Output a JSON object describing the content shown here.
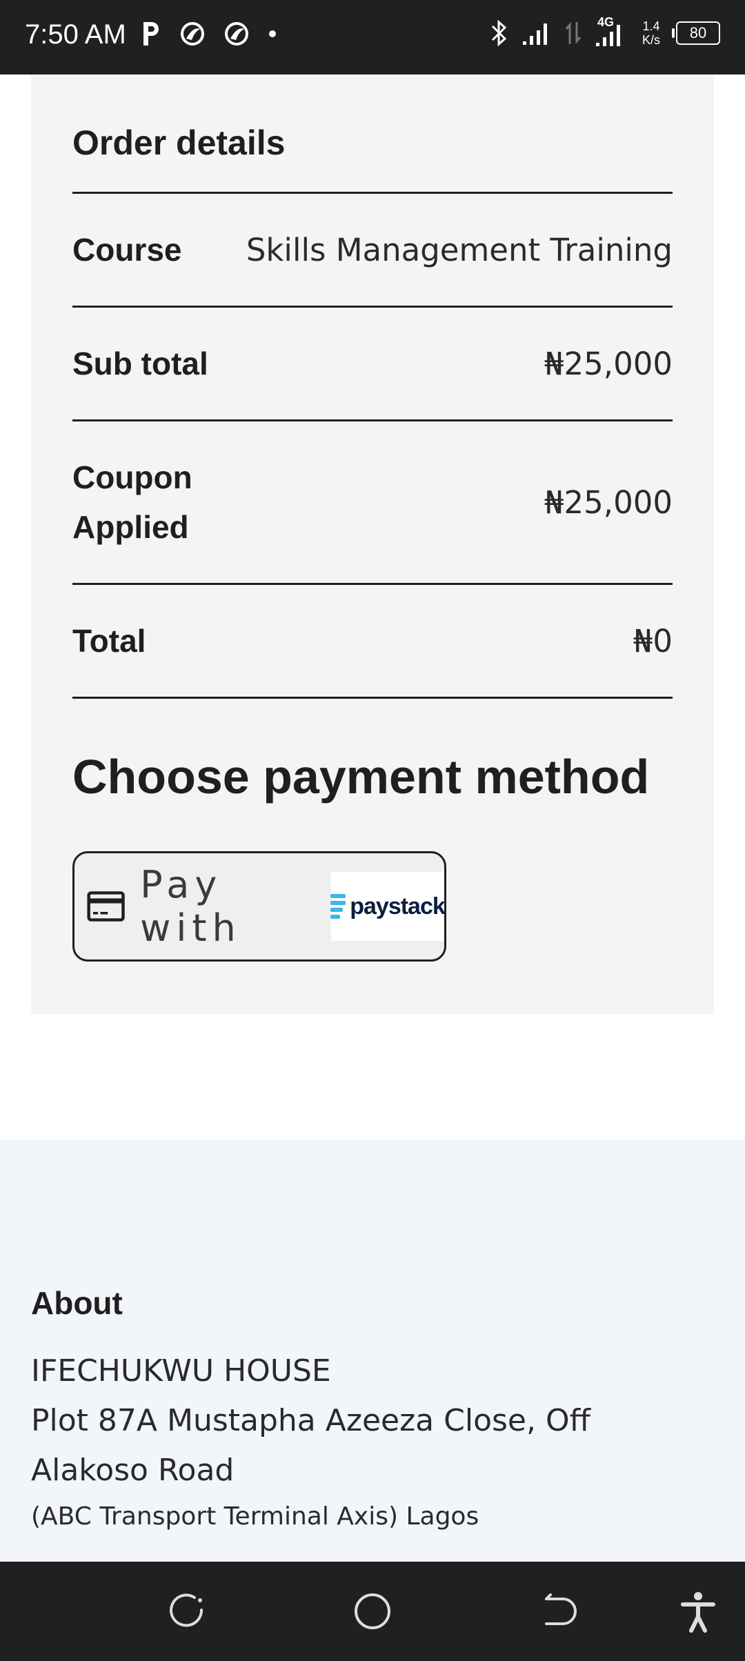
{
  "status_bar": {
    "time": "7:50 AM",
    "net_speed_value": "1.4",
    "net_speed_unit": "K/s",
    "network_type": "4G",
    "battery": "80",
    "icons": [
      "parking-icon",
      "bird-icon",
      "bird-icon",
      "dot-icon",
      "bluetooth-icon",
      "signal-icon",
      "data-arrows-icon",
      "signal-4g-icon",
      "battery-icon"
    ]
  },
  "order": {
    "title": "Order details",
    "rows": [
      {
        "label": "Course",
        "value": "Skills Management Training"
      },
      {
        "label": "Sub total",
        "value": "₦25,000"
      },
      {
        "label": "Coupon Applied",
        "value": "₦25,000"
      },
      {
        "label": "Total",
        "value": "₦0"
      }
    ]
  },
  "payment": {
    "title": "Choose payment method",
    "button_label": "Pay with",
    "provider_logo_text": "paystack",
    "icon": "credit-card-icon"
  },
  "footer": {
    "about_title": "About",
    "address_line1": "IFECHUKWU HOUSE",
    "address_line2": "Plot 87A Mustapha Azeeza Close, Off Alakoso Road",
    "address_line3": "(ABC Transport Terminal Axis) Lagos"
  },
  "nav_bar": {
    "buttons": [
      "recents-icon",
      "home-icon",
      "back-icon",
      "accessibility-icon"
    ]
  },
  "colors": {
    "card_bg": "#f4f4f4",
    "footer_bg": "#f2f5fa",
    "bar_bg": "#202020",
    "paystack_blue": "#3bb7e7"
  }
}
